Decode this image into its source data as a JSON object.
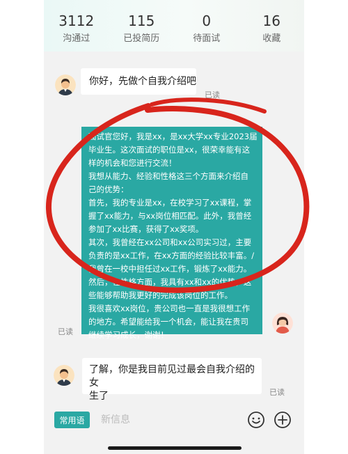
{
  "stats": [
    {
      "value": "3112",
      "label": "沟通过"
    },
    {
      "value": "115",
      "label": "已投简历"
    },
    {
      "value": "0",
      "label": "待面试"
    },
    {
      "value": "16",
      "label": "收藏"
    }
  ],
  "messages": {
    "m1": {
      "text": "你好，先做个自我介绍吧",
      "read": "已读"
    },
    "m2": {
      "lines": [
        "面试官您好，我是xx，是xx大学xx专业2023届",
        "毕业生。这次面试的职位是xx，很荣幸能有这",
        "样的机会和您进行交流！",
        "我想从能力、经验和性格这三个方面来介绍自",
        "己的优势：",
        "首先，我的专业是xx，在校学习了xx课程，掌",
        "握了xx能力，与xx岗位相匹配。此外，我曾经",
        "参加了xx比赛，获得了xx奖项。",
        "其次，我曾经在xx公司和xx公司实习过，主要",
        "负责的是xx工作，在xx方面的经验比较丰富。/",
        "我曾在一校中担任过xx工作，锻炼了xx能力。",
        "然后，在性格方面，我具有xx和xx的优势，这",
        "些能够帮助我更好的完成该岗位的工作。",
        "我很喜欢xx岗位，贵公司也一直是我很想工作",
        "的地方。希望能给我一个机会，能让我在贵司",
        "继续学习成长，谢谢！"
      ],
      "read": "已读"
    },
    "m3": {
      "line1": "了解，你是我目前见过最会自我介绍的女",
      "line2": "生了",
      "read": "已读"
    }
  },
  "input_bar": {
    "quick_reply_label": "常用语",
    "placeholder": "新信息",
    "emoji_icon": "smile-icon",
    "plus_icon": "plus-circle-icon"
  },
  "colors": {
    "accent": "#2aa8a3",
    "annotation": "#d8251c"
  }
}
